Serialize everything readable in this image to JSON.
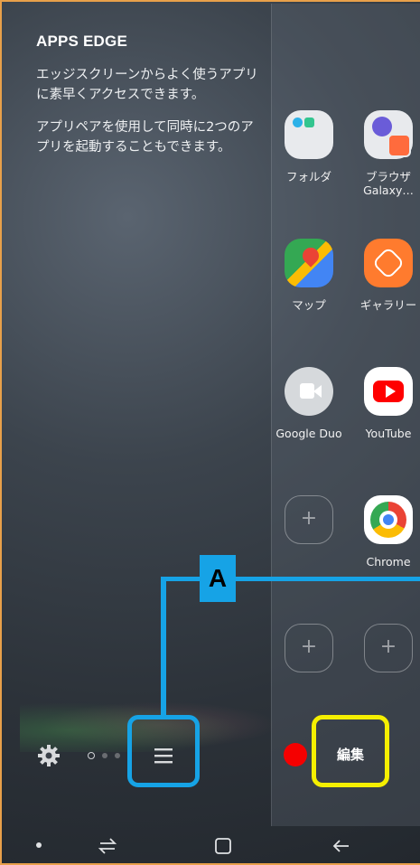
{
  "panel": {
    "title": "APPS EDGE",
    "description1": "エッジスクリーンからよく使うアプリに素早くアクセスできます。",
    "description2": "アプリペアを使用して同時に2つのアプリを起動することもできます。"
  },
  "apps": [
    {
      "label": "フォルダ",
      "icon": "folder-icon"
    },
    {
      "label": "ブラウザ\nGalaxy…",
      "label1": "ブラウザ",
      "label2": "Galaxy…",
      "icon": "samsung-internet-icon"
    },
    {
      "label": "マップ",
      "icon": "google-maps-icon"
    },
    {
      "label": "ギャラリー",
      "icon": "gallery-icon"
    },
    {
      "label": "Google Duo",
      "icon": "google-duo-icon"
    },
    {
      "label": "YouTube",
      "icon": "youtube-icon"
    },
    {
      "label": "",
      "icon": "add-app-icon"
    },
    {
      "label": "Chrome",
      "icon": "chrome-icon"
    }
  ],
  "annotations": {
    "a_label": "A",
    "edit_label": "編集",
    "colors": {
      "blue": "#16a3e6",
      "yellow": "#f5ef00",
      "red": "#f50000"
    }
  },
  "bottom": {
    "settings_icon": "gear-icon",
    "menu_icon": "hamburger-menu-icon",
    "page_indicator_count": 3
  }
}
